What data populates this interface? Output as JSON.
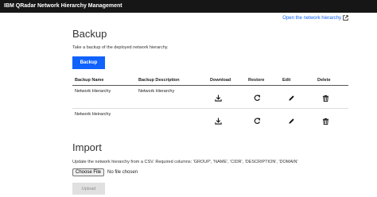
{
  "header": {
    "title": "IBM QRadar Network Hierarchy Management"
  },
  "links": {
    "open_hierarchy": "Open the network hierarchy"
  },
  "backup": {
    "title": "Backup",
    "description": "Take a backup of the deployed network hierarchy.",
    "button_label": "Backup",
    "columns": [
      "Backup Name",
      "Backup Description",
      "Download",
      "Restore",
      "Edit",
      "Delete"
    ],
    "rows": [
      {
        "name": "Network Hierarchy",
        "description": "Network Hierarchy"
      },
      {
        "name": "Network Heirarchy",
        "description": ""
      }
    ]
  },
  "import": {
    "title": "Import",
    "description": "Update the network hierarchy from a CSV. Required columns: 'GROUP', 'NAME', 'CIDR', 'DESCRIPTION', 'DOMAIN'",
    "choose_file_label": "Choose File",
    "no_file_text": "No file chosen",
    "upload_label": "Upload"
  },
  "colors": {
    "primary": "#0f62fe",
    "topbar": "#161616",
    "disabled": "#e0e0e0"
  }
}
